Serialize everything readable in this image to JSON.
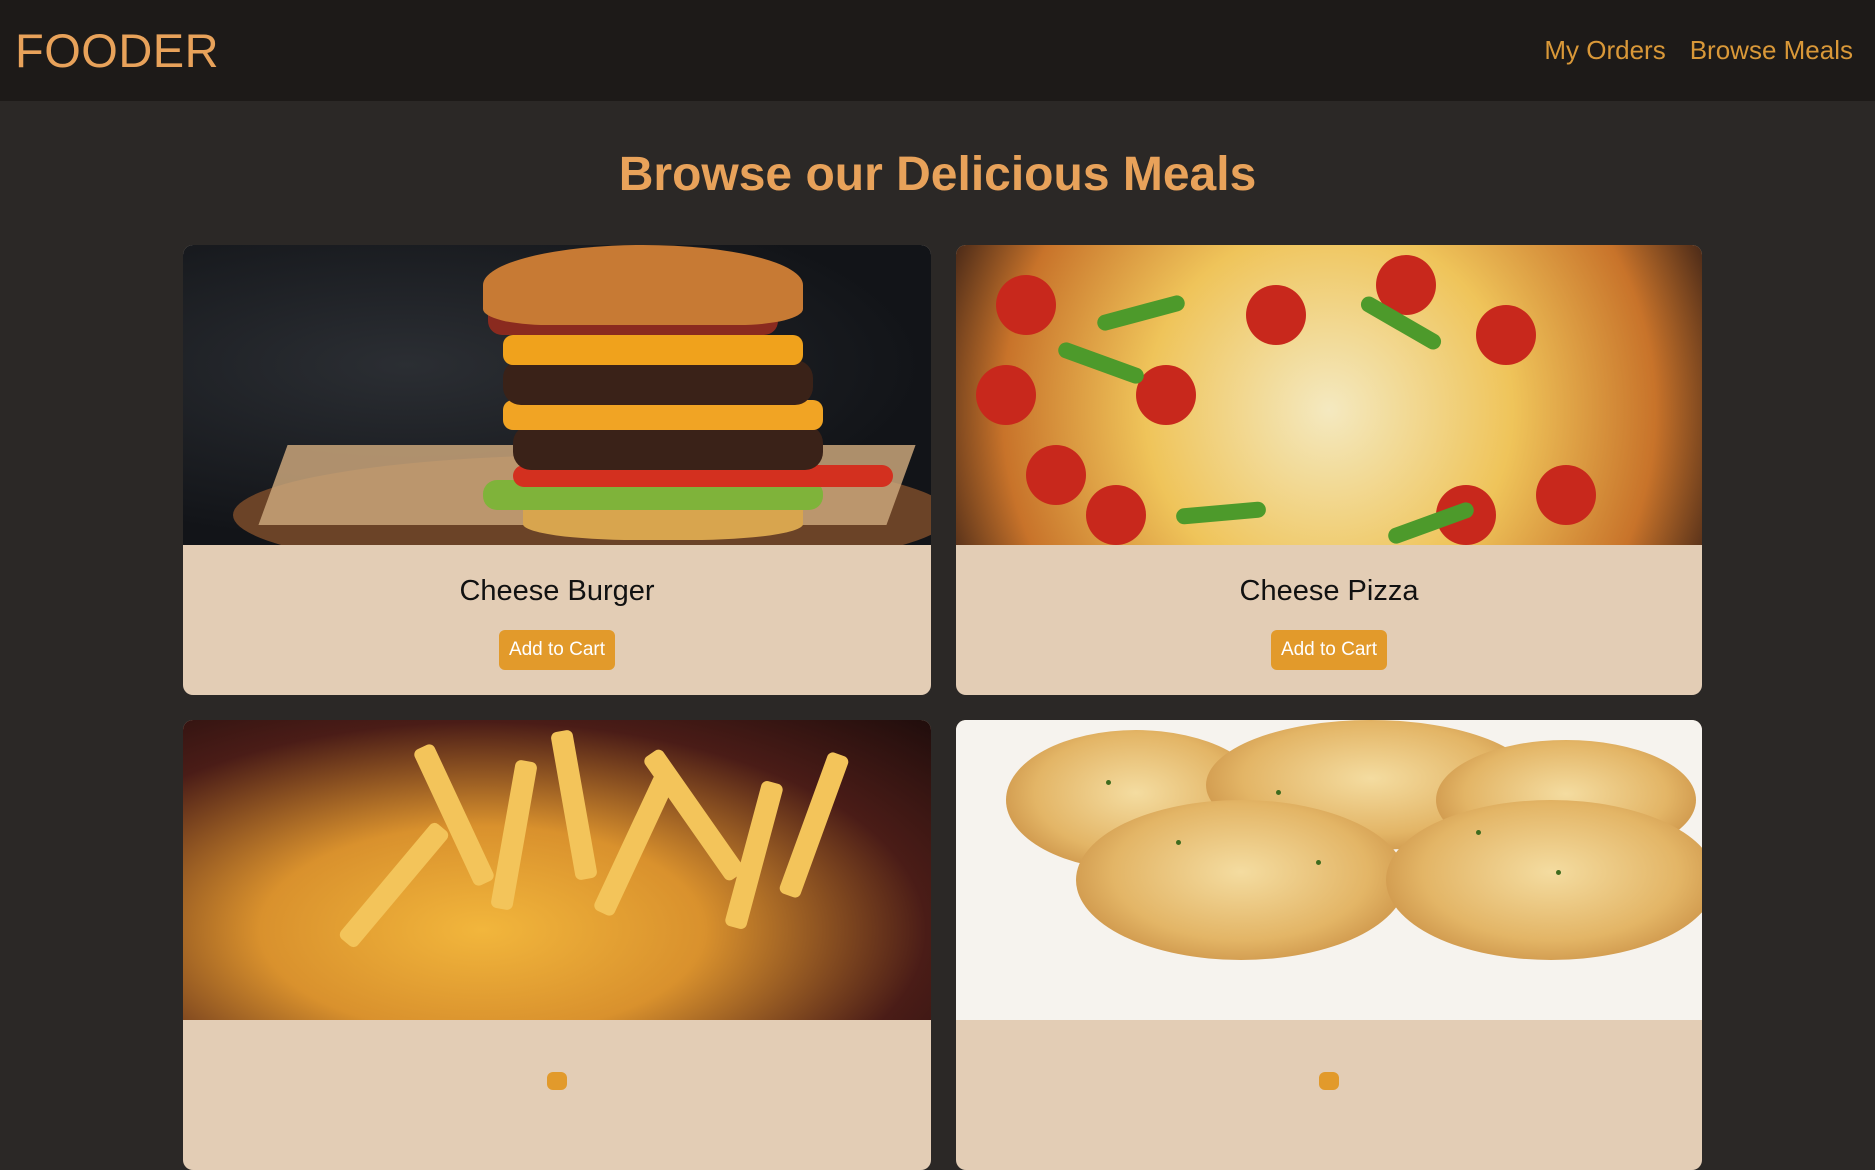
{
  "nav": {
    "brand": "FOODER",
    "links": [
      "My Orders",
      "Browse Meals"
    ]
  },
  "main": {
    "heading": "Browse our Delicious Meals",
    "meals": [
      {
        "title": "Cheese Burger",
        "button": "Add to Cart",
        "image": "burger-photo"
      },
      {
        "title": "Cheese Pizza",
        "button": "Add to Cart",
        "image": "pizza-photo"
      },
      {
        "title": "",
        "button": "",
        "image": "fries-photo"
      },
      {
        "title": "",
        "button": "",
        "image": "garlic-bread-photo"
      }
    ]
  },
  "colors": {
    "background": "#2b2826",
    "header": "#1d1a18",
    "accent": "#e8a25a",
    "card": "#e3cdb5",
    "button": "#e29a2b"
  }
}
